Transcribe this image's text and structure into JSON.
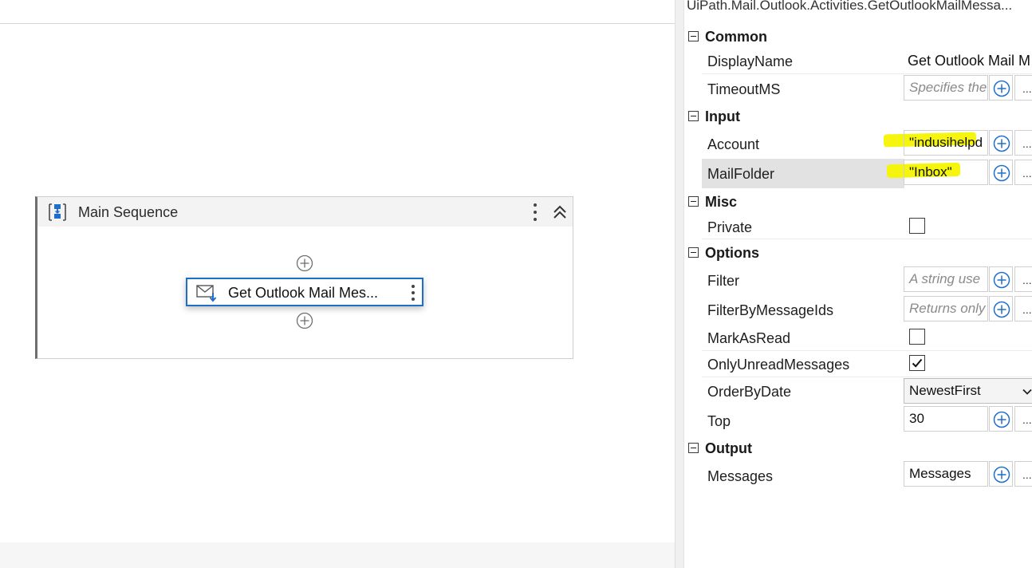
{
  "designer": {
    "sequence": {
      "title": "Main Sequence"
    },
    "activity": {
      "title": "Get Outlook Mail Mes..."
    }
  },
  "properties": {
    "panel_title": "UiPath.Mail.Outlook.Activities.GetOutlookMailMessa...",
    "categories": {
      "common": "Common",
      "input": "Input",
      "misc": "Misc",
      "options": "Options",
      "output": "Output"
    },
    "rows": {
      "display_name": {
        "label": "DisplayName",
        "value": "Get Outlook Mail M"
      },
      "timeout_ms": {
        "label": "TimeoutMS",
        "placeholder": "Specifies the"
      },
      "account": {
        "label": "Account",
        "value": "\"indusihelpd"
      },
      "mail_folder": {
        "label": "MailFolder",
        "value": "\"Inbox\""
      },
      "private": {
        "label": "Private",
        "checked": false
      },
      "filter": {
        "label": "Filter",
        "placeholder": "A string use"
      },
      "filter_by_message_ids": {
        "label": "FilterByMessageIds",
        "placeholder": "Returns only"
      },
      "mark_as_read": {
        "label": "MarkAsRead",
        "checked": false
      },
      "only_unread_messages": {
        "label": "OnlyUnreadMessages",
        "checked": true
      },
      "order_by_date": {
        "label": "OrderByDate",
        "value": "NewestFirst"
      },
      "top": {
        "label": "Top",
        "value": "30"
      },
      "messages": {
        "label": "Messages",
        "value": "Messages"
      }
    },
    "more_label": "...",
    "highlight_color": "#f4f400",
    "accent_color": "#1f6fc7"
  }
}
